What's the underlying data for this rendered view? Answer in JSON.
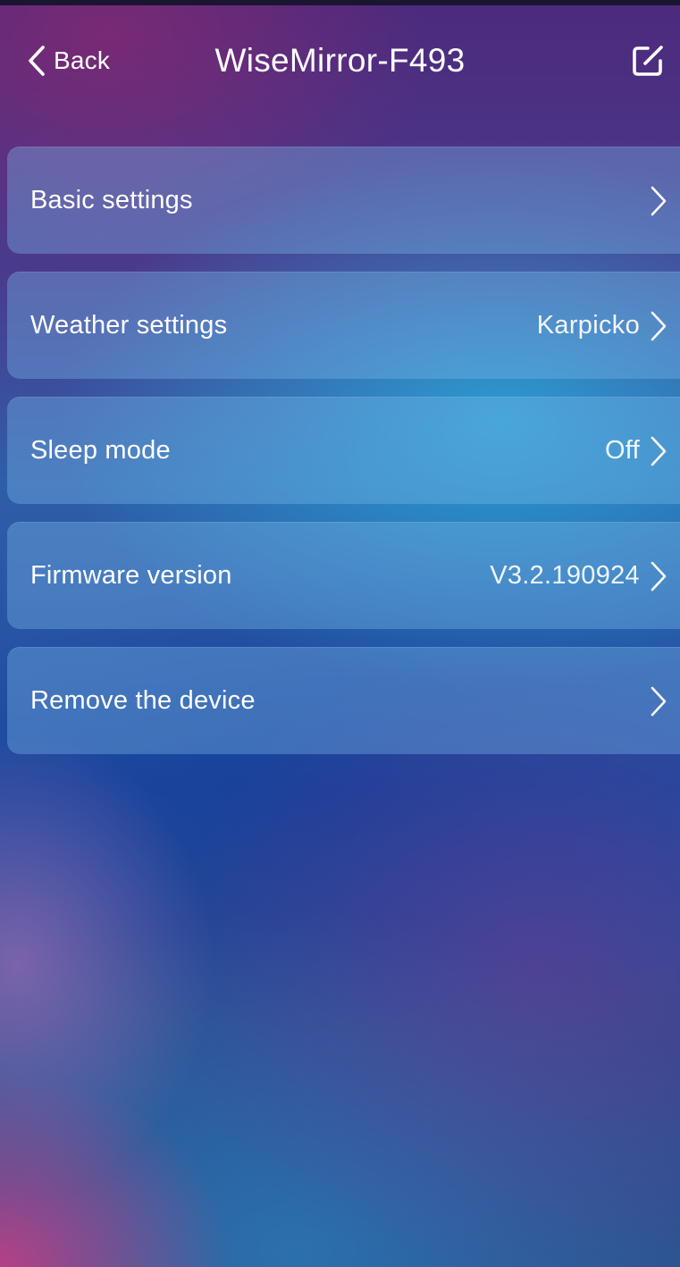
{
  "header": {
    "back_label": "Back",
    "title": "WiseMirror-F493",
    "back_icon": "chevron-left-icon",
    "edit_icon": "edit-icon"
  },
  "settings": {
    "items": [
      {
        "label": "Basic settings",
        "value": ""
      },
      {
        "label": "Weather settings",
        "value": "Karpicko"
      },
      {
        "label": "Sleep mode",
        "value": "Off"
      },
      {
        "label": "Firmware version",
        "value": "V3.2.190924"
      },
      {
        "label": "Remove the device",
        "value": ""
      }
    ],
    "chevron_icon": "chevron-right-icon"
  },
  "colors": {
    "text": "#ffffff",
    "row_background": "rgba(120,185,235,0.38)",
    "background_top": "#4c2a7c",
    "background_mid": "#2f5ea8",
    "background_bottom": "#2e4e8c"
  }
}
